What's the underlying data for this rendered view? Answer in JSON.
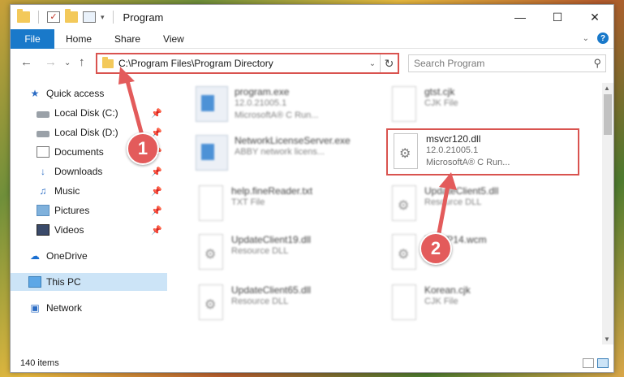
{
  "window": {
    "title": "Program"
  },
  "ribbon": {
    "tabs": [
      "File",
      "Home",
      "Share",
      "View"
    ]
  },
  "nav": {
    "address": "C:\\Program Files\\Program Directory",
    "search_placeholder": "Search Program"
  },
  "sidebar": {
    "items": [
      {
        "label": "Quick access",
        "icon": "star-icon",
        "pinned": false
      },
      {
        "label": "Local Disk (C:)",
        "icon": "drive-icon",
        "pinned": true
      },
      {
        "label": "Local Disk (D:)",
        "icon": "drive-icon",
        "pinned": true
      },
      {
        "label": "Documents",
        "icon": "documents-icon",
        "pinned": true
      },
      {
        "label": "Downloads",
        "icon": "downloads-icon",
        "pinned": true
      },
      {
        "label": "Music",
        "icon": "music-icon",
        "pinned": true
      },
      {
        "label": "Pictures",
        "icon": "pictures-icon",
        "pinned": true
      },
      {
        "label": "Videos",
        "icon": "videos-icon",
        "pinned": true
      },
      {
        "label": "OneDrive",
        "icon": "onedrive-icon",
        "pinned": false
      },
      {
        "label": "This PC",
        "icon": "this-pc-icon",
        "pinned": false,
        "selected": true
      },
      {
        "label": "Network",
        "icon": "network-icon",
        "pinned": false
      }
    ]
  },
  "files": [
    {
      "name": "program.exe",
      "line1": "12.0.21005.1",
      "line2": "MicrosoftA® C Run..."
    },
    {
      "name": "gtst.cjk",
      "line1": "CJK File",
      "line2": ""
    },
    {
      "name": "NetworkLicenseServer.exe",
      "line1": "ABBY network licens...",
      "line2": ""
    },
    {
      "name": "msvcr120.dll",
      "line1": "12.0.21005.1",
      "line2": "MicrosoftA® C Run..."
    },
    {
      "name": "help.fineReader.txt",
      "line1": "TXT File",
      "line2": ""
    },
    {
      "name": "UpdateClient5.dll",
      "line1": "Resource DLL",
      "line2": ""
    },
    {
      "name": "UpdateClient19.dll",
      "line1": "Resource DLL",
      "line2": ""
    },
    {
      "name": "FixWP14.wcm",
      "line1": "File",
      "line2": ""
    },
    {
      "name": "UpdateClient65.dll",
      "line1": "Resource DLL",
      "line2": ""
    },
    {
      "name": "Korean.cjk",
      "line1": "CJK File",
      "line2": ""
    }
  ],
  "status": {
    "item_count": "140 items"
  },
  "callouts": {
    "step1": "1",
    "step2": "2"
  },
  "colors": {
    "accent": "#1979ca",
    "highlight": "#d9534f",
    "badge": "#e35b5b"
  }
}
